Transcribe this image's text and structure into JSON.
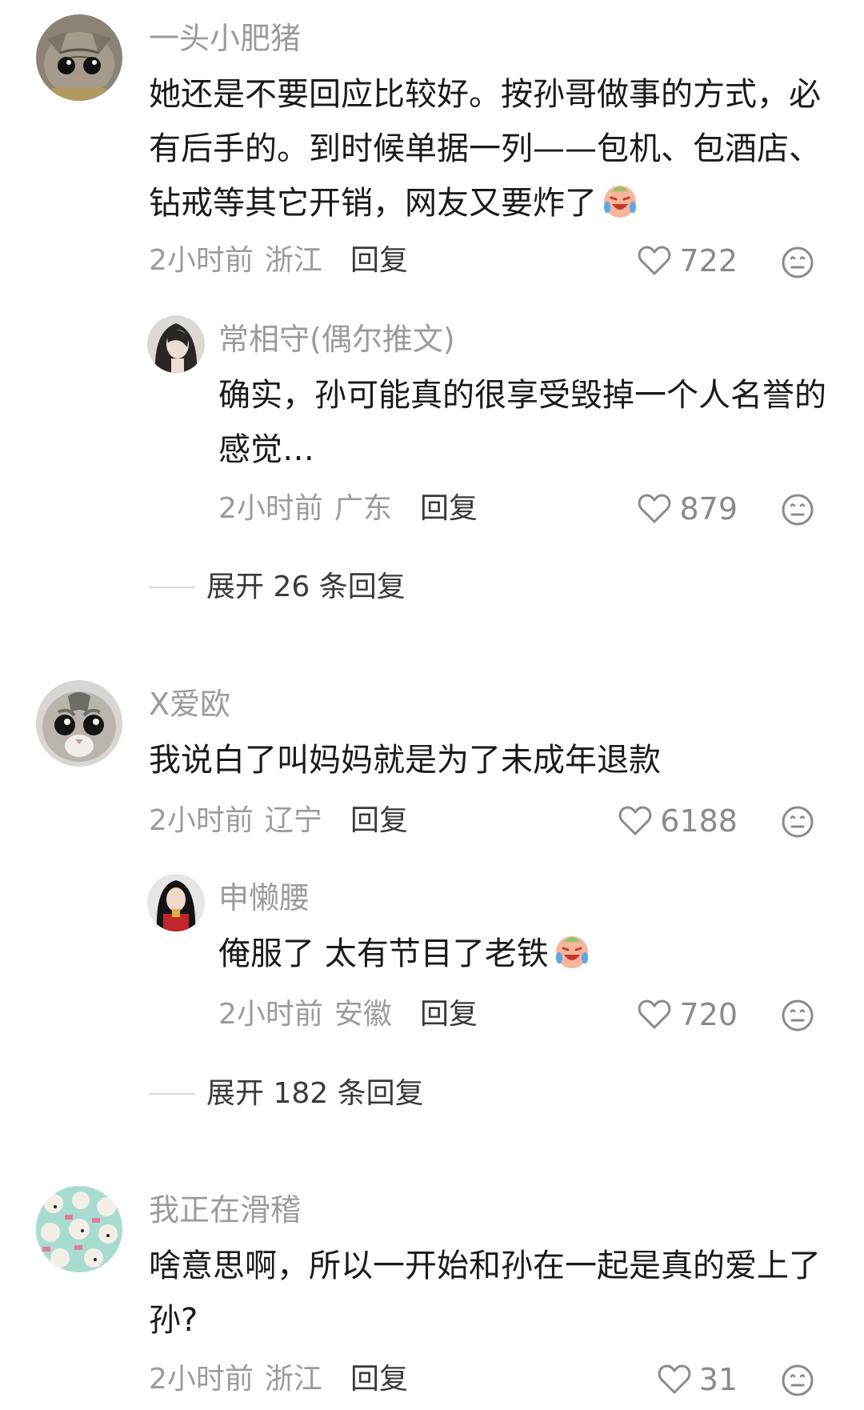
{
  "comments": [
    {
      "username": "一头小肥猪",
      "text": "她还是不要回应比较好。按孙哥做事的方式，必有后手的。到时候单据一列——包机、包酒店、钻戒等其它开销，网友又要炸了",
      "emoji": "crying-laughing-face",
      "time": "2小时前",
      "location": "浙江",
      "reply_label": "回复",
      "likes": "722",
      "reply": {
        "username": "常相守(偶尔推文)",
        "text": "确实，孙可能真的很享受毁掉一个人名誉的感觉…",
        "time": "2小时前",
        "location": "广东",
        "reply_label": "回复",
        "likes": "879"
      },
      "expand_label": "展开 26 条回复"
    },
    {
      "username": "X爱欧",
      "text": "我说白了叫妈妈就是为了未成年退款",
      "time": "2小时前",
      "location": "辽宁",
      "reply_label": "回复",
      "likes": "6188",
      "reply": {
        "username": "申懒腰",
        "text": "俺服了 太有节目了老铁",
        "emoji": "crying-laughing-face",
        "time": "2小时前",
        "location": "安徽",
        "reply_label": "回复",
        "likes": "720"
      },
      "expand_label": "展开 182 条回复"
    },
    {
      "username": "我正在滑稽",
      "text": "啥意思啊，所以一开始和孙在一起是真的爱上了孙?",
      "time": "2小时前",
      "location": "浙江",
      "reply_label": "回复",
      "likes": "31"
    }
  ],
  "colors": {
    "username": "#9b9b9b",
    "text": "#1a1a1a",
    "meta": "#9b9b9b",
    "action": "#3a3a3a",
    "icon": "#8a8a8a"
  }
}
